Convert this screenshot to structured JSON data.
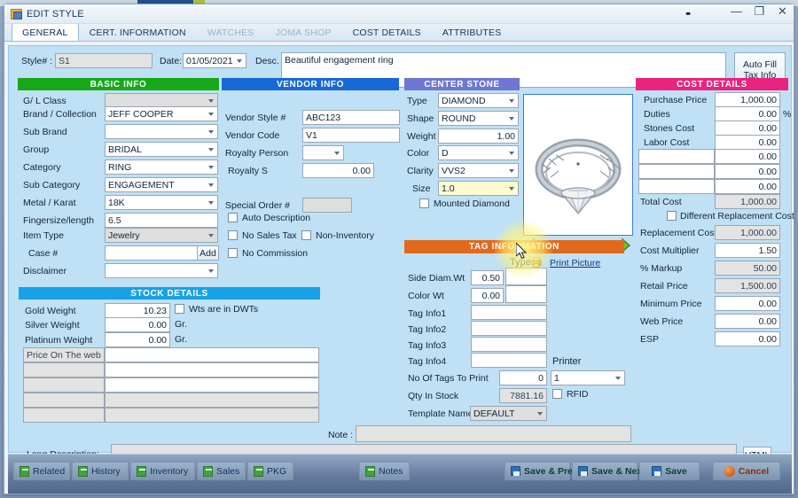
{
  "window": {
    "title": "EDIT STYLE",
    "minimize": "—",
    "maximize": "❐",
    "close": "✕",
    "drag_handle": "••"
  },
  "tabs": [
    {
      "label": "GENERAL",
      "active": true,
      "disabled": false
    },
    {
      "label": "CERT. INFORMATION",
      "active": false,
      "disabled": false
    },
    {
      "label": "WATCHES",
      "active": false,
      "disabled": true
    },
    {
      "label": "JOMA SHOP",
      "active": false,
      "disabled": true
    },
    {
      "label": "COST DETAILS",
      "active": false,
      "disabled": false
    },
    {
      "label": "ATTRIBUTES",
      "active": false,
      "disabled": false
    }
  ],
  "header": {
    "style_label": "Style# :",
    "style_value": "S1",
    "date_label": "Date:",
    "date_value": "01/05/2021",
    "desc_label": "Desc.",
    "desc_value": "Beautiful engagement ring",
    "autofill_line1": "Auto Fill",
    "autofill_line2": "Tax Info"
  },
  "basic_info": {
    "title": "BASIC INFO",
    "color": "#17a81a",
    "fields": [
      {
        "label": "G/ L Class",
        "value": "",
        "type": "combo",
        "readonly": true
      },
      {
        "label": "Brand / Collection",
        "value": "JEFF COOPER",
        "type": "combo",
        "readonly": false
      },
      {
        "label": "Sub Brand",
        "value": "",
        "type": "combo",
        "readonly": false
      },
      {
        "label": "Group",
        "value": "BRIDAL",
        "type": "combo",
        "readonly": false
      },
      {
        "label": "Category",
        "value": "RING",
        "type": "combo",
        "readonly": false
      },
      {
        "label": "Sub Category",
        "value": "ENGAGEMENT",
        "type": "combo",
        "readonly": false
      },
      {
        "label": "Metal / Karat",
        "value": "18K",
        "type": "combo",
        "readonly": false
      },
      {
        "label": "Fingersize/length",
        "value": "6.5",
        "type": "text",
        "readonly": false
      },
      {
        "label": "Item Type",
        "value": "Jewelry",
        "type": "combo",
        "readonly": true
      },
      {
        "label": "Case #",
        "value": "",
        "type": "text-add",
        "readonly": false,
        "button": "Add"
      },
      {
        "label": "Disclaimer",
        "value": "",
        "type": "combo",
        "readonly": false
      }
    ]
  },
  "vendor_info": {
    "title": "VENDOR INFO",
    "color": "#1769d8",
    "fields": [
      {
        "label": "Vendor Style #",
        "value": "ABC123",
        "type": "text"
      },
      {
        "label": "Vendor Code",
        "value": "V1",
        "type": "text"
      },
      {
        "label": "Royalty Person",
        "value": "",
        "type": "combo"
      },
      {
        "label": "Royalty S",
        "value": "0.00",
        "type": "num"
      },
      {
        "label": "Special Order #",
        "value": "",
        "type": "gray"
      }
    ],
    "checkboxes": [
      {
        "label": "Auto Description",
        "checked": false
      },
      {
        "label": "No Sales Tax",
        "checked": false
      },
      {
        "label": "Non-Inventory",
        "checked": false
      },
      {
        "label": "No Commission",
        "checked": false
      }
    ]
  },
  "center_stone": {
    "title": "CENTER STONE",
    "color": "#6e77d4",
    "fields": [
      {
        "label": "Type",
        "value": "DIAMOND",
        "type": "combo"
      },
      {
        "label": "Shape",
        "value": "ROUND",
        "type": "combo"
      },
      {
        "label": "Weight",
        "value": "1.00",
        "type": "num"
      },
      {
        "label": "Color",
        "value": "D",
        "type": "combo"
      },
      {
        "label": "Clarity",
        "value": "VVS2",
        "type": "combo"
      },
      {
        "label": "Size",
        "value": "1.0",
        "type": "combo",
        "highlighted": true
      }
    ],
    "mounted_label": "Mounted Diamond",
    "mounted_checked": false
  },
  "picture": {
    "print_link": "Print Picture",
    "prev_icon": "left-green-arrow",
    "next_icon": "right-green-arrow",
    "image_alt": "diamond engagement ring"
  },
  "cost_details": {
    "title": "COST DETAILS",
    "color": "#e8247e",
    "rows": [
      {
        "label": "Purchase Price",
        "value": "1,000.00",
        "readonly": false,
        "suffix": ""
      },
      {
        "label": "Duties",
        "value": "0.00",
        "readonly": false,
        "suffix": "%"
      },
      {
        "label": "Stones Cost",
        "value": "0.00",
        "readonly": false,
        "suffix": ""
      },
      {
        "label": "Labor Cost",
        "value": "0.00",
        "readonly": false,
        "suffix": ""
      },
      {
        "label": "",
        "value": "0.00",
        "readonly": false,
        "suffix": "",
        "editable_label": true
      },
      {
        "label": "",
        "value": "0.00",
        "readonly": false,
        "suffix": "",
        "editable_label": true
      },
      {
        "label": "",
        "value": "0.00",
        "readonly": false,
        "suffix": "",
        "editable_label": true
      },
      {
        "label": "Total Cost",
        "value": "1,000.00",
        "readonly": true,
        "suffix": ""
      }
    ],
    "diff_replacement_label": "Different Replacement Cost",
    "diff_replacement_checked": false,
    "rows2": [
      {
        "label": "Replacement Cost",
        "value": "1,000.00",
        "readonly": true
      },
      {
        "label": "Cost Multiplier",
        "value": "1.50",
        "readonly": false
      },
      {
        "label": "% Markup",
        "value": "50.00",
        "readonly": true
      },
      {
        "label": "Retail Price",
        "value": "1,500.00",
        "readonly": true
      },
      {
        "label": "Minimum Price",
        "value": "0.00",
        "readonly": false
      },
      {
        "label": "Web Price",
        "value": "0.00",
        "readonly": false
      },
      {
        "label": "ESP",
        "value": "0.00",
        "readonly": false
      }
    ]
  },
  "stock_details": {
    "title": "STOCK DETAILS",
    "color": "#17a2e8",
    "rows": [
      {
        "label": "Gold Weight",
        "value": "10.23",
        "unit": ""
      },
      {
        "label": "Silver Weight",
        "value": "0.00",
        "unit": "Gr."
      },
      {
        "label": "Platinum Weight",
        "value": "0.00",
        "unit": "Gr."
      }
    ],
    "dwt_label": "Wts are in DWTs",
    "dwt_checked": false,
    "grid_rows": [
      {
        "label": "Price On  The web",
        "value": ""
      },
      {
        "label": "",
        "value": ""
      },
      {
        "label": "",
        "value": ""
      },
      {
        "label": "",
        "value": ""
      },
      {
        "label": "",
        "value": ""
      }
    ]
  },
  "tag_information": {
    "title": "TAG INFORMATION",
    "color": "#e2691c",
    "type_header": "Type",
    "printer_header": "Printer",
    "rows": [
      {
        "label": "Side Diam.Wt",
        "value": "0.50",
        "type_value": ""
      },
      {
        "label": "Color Wt",
        "value": "0.00",
        "type_value": ""
      }
    ],
    "tag_infos": [
      {
        "label": "Tag Info1",
        "value": ""
      },
      {
        "label": "Tag Info2",
        "value": ""
      },
      {
        "label": "Tag Info3",
        "value": ""
      },
      {
        "label": "Tag Info4",
        "value": ""
      }
    ],
    "tags_to_print_label": "No Of Tags To Print",
    "tags_to_print_value": "0",
    "printer_value": "1",
    "qty_label": "Qty In Stock",
    "qty_value": "7881.16",
    "rfid_label": "RFID",
    "rfid_checked": false,
    "template_label": "Template Name",
    "template_value": "DEFAULT"
  },
  "note": {
    "label": "Note :",
    "value": ""
  },
  "long_description": {
    "label": "Long Description:",
    "value": "",
    "html_button": "HTML"
  },
  "toolbar": {
    "left": [
      {
        "label": "Related",
        "icon": "document-icon"
      },
      {
        "label": "History",
        "icon": "document-icon"
      },
      {
        "label": "Inventory",
        "icon": "document-icon"
      },
      {
        "label": "Sales",
        "icon": "document-icon"
      },
      {
        "label": "PKG",
        "icon": "document-icon"
      }
    ],
    "center": [
      {
        "label": "Notes",
        "icon": "document-icon"
      }
    ],
    "right": [
      {
        "label": "Save & Prev.",
        "icon": "floppy-icon",
        "kind": "save"
      },
      {
        "label": "Save & Next",
        "icon": "floppy-icon",
        "kind": "save"
      },
      {
        "label": "Save",
        "icon": "floppy-icon",
        "kind": "save"
      },
      {
        "label": "Cancel",
        "icon": "cancel-icon",
        "kind": "cancel"
      }
    ]
  }
}
